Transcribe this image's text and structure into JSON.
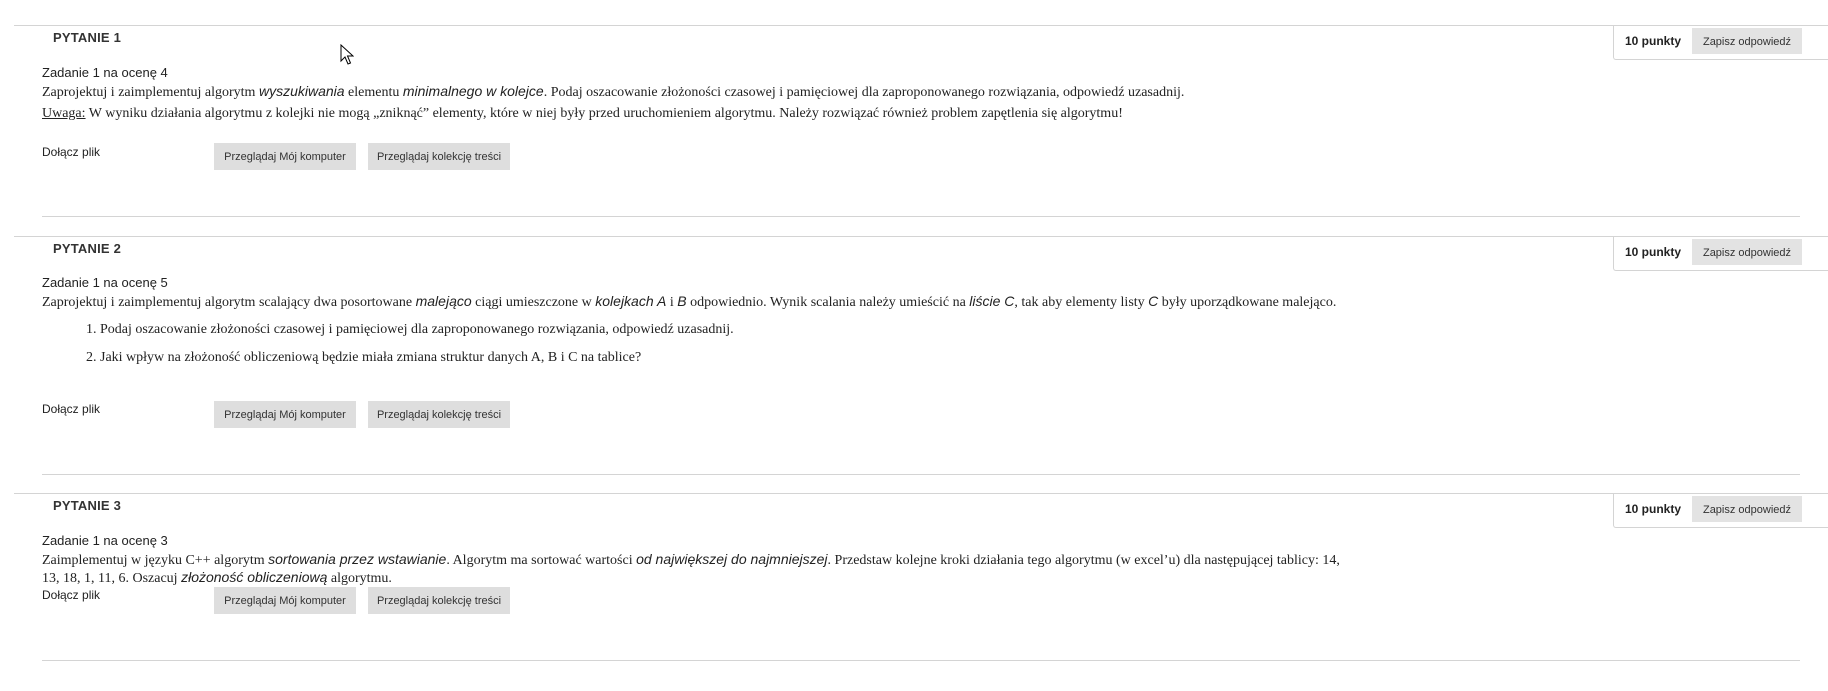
{
  "questions": [
    {
      "title": "PYTANIE 1",
      "points": "10 punkty",
      "save_label": "Zapisz odpowiedź",
      "subtitle": "Zadanie 1 na ocenę 4",
      "line1": {
        "t1": "Zaprojektuj i zaimplementuj algorytm ",
        "i1": "wyszukiwania",
        "t2": " elementu ",
        "i2": "minimalnego w kolejce",
        "t3": ". Podaj oszacowanie złożoności czasowej i pamięciowej dla zaproponowanego rozwiązania, odpowiedź uzasadnij."
      },
      "line2": {
        "u": "Uwaga:",
        "t": " W wyniku działania algorytmu z kolejki nie mogą „zniknąć” elementy, które w niej były przed uruchomieniem algorytmu. Należy rozwiązać również problem zapętlenia się algorytmu!"
      },
      "attach_label": "Dołącz plik",
      "browse_local": "Przeglądaj Mój komputer",
      "browse_collection": "Przeglądaj kolekcję treści"
    },
    {
      "title": "PYTANIE 2",
      "points": "10 punkty",
      "save_label": "Zapisz odpowiedź",
      "subtitle": "Zadanie 1 na ocenę 5",
      "line1": {
        "t1": "Zaprojektuj i zaimplementuj algorytm scalający dwa posortowane ",
        "i1": "malejąco",
        "t2": " ciągi umieszczone w ",
        "i2": "kolejkach A",
        "t3": " i ",
        "i3": "B",
        "t4": " odpowiednio. Wynik scalania należy umieścić na ",
        "i4": "liście C",
        "t5": ", tak aby elementy listy ",
        "i5": "C",
        "t6": " były uporządkowane malejąco."
      },
      "list": [
        "1. Podaj oszacowanie złożoności czasowej i pamięciowej dla zaproponowanego rozwiązania, odpowiedź uzasadnij.",
        "2. Jaki wpływ na złożoność obliczeniową będzie miała zmiana struktur danych A, B i C na tablice?"
      ],
      "attach_label": "Dołącz plik",
      "browse_local": "Przeglądaj Mój komputer",
      "browse_collection": "Przeglądaj kolekcję treści"
    },
    {
      "title": "PYTANIE 3",
      "points": "10 punkty",
      "save_label": "Zapisz odpowiedź",
      "subtitle": "Zadanie 1 na ocenę 3",
      "line1": {
        "t1": "Zaimplementuj w języku C++ algorytm ",
        "i1": "sortowania przez wstawianie",
        "t2": ". Algorytm ma sortować wartości ",
        "i2": "od największej do najmniejszej",
        "t3": ". Przedstaw kolejne kroki działania tego algorytmu (w excel’u) dla następującej tablicy: 14,"
      },
      "line2": {
        "t1": "13, 18, 1, 11, 6. Oszacuj ",
        "i1": "złożoność obliczeniową",
        "t2": " algorytmu."
      },
      "attach_label": "Dołącz plik",
      "browse_local": "Przeglądaj Mój komputer",
      "browse_collection": "Przeglądaj kolekcję treści"
    }
  ]
}
